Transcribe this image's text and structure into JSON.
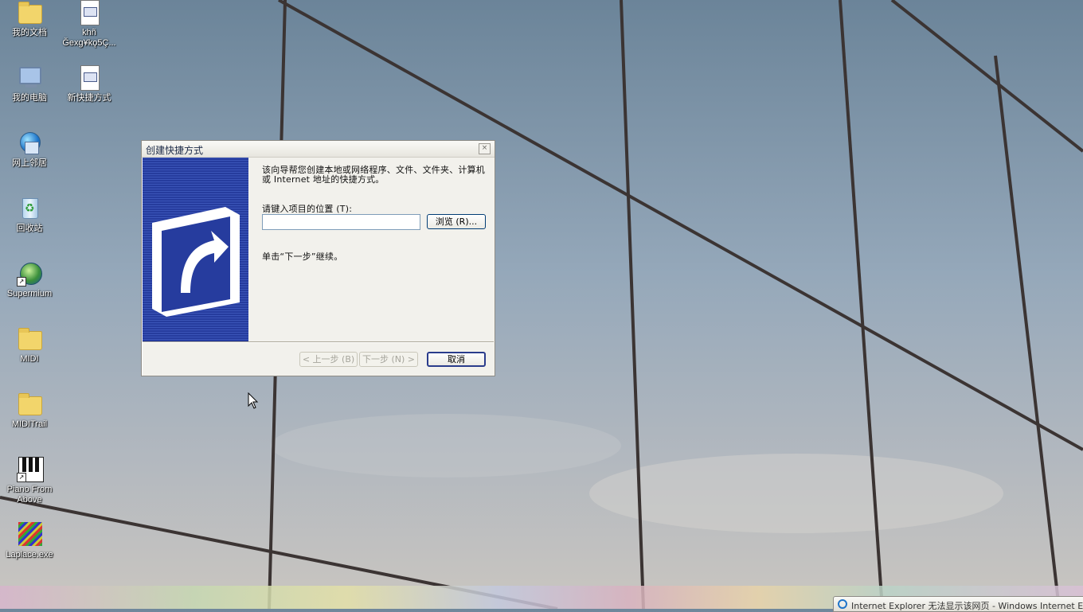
{
  "desktop": {
    "icons": [
      {
        "name": "my-documents",
        "label": "我的文档"
      },
      {
        "name": "file-khn",
        "label": "khñ Ğexg¥kǫ5Ç..."
      },
      {
        "name": "my-computer",
        "label": "我的电脑"
      },
      {
        "name": "new-shortcut",
        "label": "新快捷方式"
      },
      {
        "name": "network-places",
        "label": "网上邻居"
      },
      {
        "name": "recycle-bin",
        "label": "回收站"
      },
      {
        "name": "supermium",
        "label": "Supermium"
      },
      {
        "name": "midi-folder",
        "label": "MIDI"
      },
      {
        "name": "miditrail-folder",
        "label": "MIDITrail"
      },
      {
        "name": "piano-from-above",
        "label": "Piano From Above"
      },
      {
        "name": "laplace-exe",
        "label": "Laplace.exe"
      }
    ]
  },
  "dialog": {
    "title": "创建快捷方式",
    "close_glyph": "×",
    "intro": "该向导帮您创建本地或网络程序、文件、文件夹、计算机或 Internet 地址的快捷方式。",
    "location_label": "请键入项目的位置 (T):",
    "location_value": "",
    "browse_label": "浏览 (R)...",
    "next_hint": "单击“下一步”继续。",
    "back_label": "< 上一步 (B)",
    "next_label": "下一步 (N) >",
    "cancel_label": "取消"
  },
  "taskbar": {
    "item_title": "Internet Explorer 无法显示该网页 - Windows Internet Explorer"
  },
  "colors": {
    "banner": "#263c9e",
    "focus_border": "#003c74"
  }
}
